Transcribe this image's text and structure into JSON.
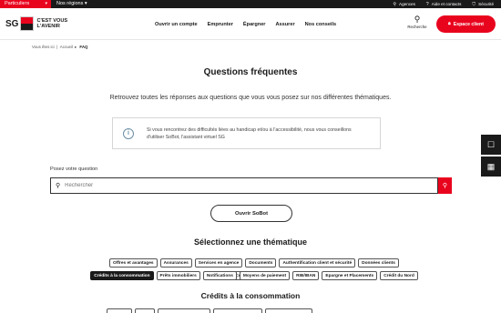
{
  "topbar": {
    "segment": "Particuliers",
    "regions": "Nos régions",
    "links": [
      {
        "icon": "location-pin-icon",
        "label": "Agences"
      },
      {
        "icon": "help-icon",
        "label": "Aide et contacts"
      },
      {
        "icon": "shield-icon",
        "label": "Sécurité"
      }
    ]
  },
  "header": {
    "logo_text": "SG",
    "tagline_1": "C'EST VOUS",
    "tagline_2": "L'AVENIR",
    "nav": [
      "Ouvrir un compte",
      "Emprunter",
      "Épargner",
      "Assurer",
      "Nos conseils"
    ],
    "search_label": "Recherche",
    "espace_client": "Espace client"
  },
  "breadcrumb": {
    "prefix": "Vous êtes ici",
    "home": "Accueil",
    "current": "FAQ"
  },
  "page": {
    "title": "Questions fréquentes",
    "intro": "Retrouvez toutes les réponses aux questions que vous vous posez sur nos différentes thématiques.",
    "info_line1": "Si vous rencontrez des difficultés liées au handicap et/ou à l'accessibilité, nous vous conseillons",
    "info_line2": "d'utiliser SoBot, l'assistant virtuel SG",
    "question_label": "Posez votre question",
    "search_placeholder": "Rechercher",
    "sobot_button": "Ouvrir SoBot",
    "theme_title": "Sélectionnez une thématique",
    "section_title": "Crédits à la consommation"
  },
  "themes_row1": [
    "Offres et avantages",
    "Assurances",
    "Services en agence",
    "Documents",
    "Authentification client et sécurité",
    "Données clients",
    "Compte et Budget"
  ],
  "themes_row2": [
    "Crédits à la consommation",
    "Prêts immobiliers",
    "Notifications",
    "Moyens de paiement",
    "RIB/IBAN",
    "Epargne et Placements",
    "Crédit du Nord"
  ],
  "active_theme": "Crédits à la consommation",
  "colors": {
    "brand_red": "#e9041e",
    "dark": "#1a1a1a"
  }
}
